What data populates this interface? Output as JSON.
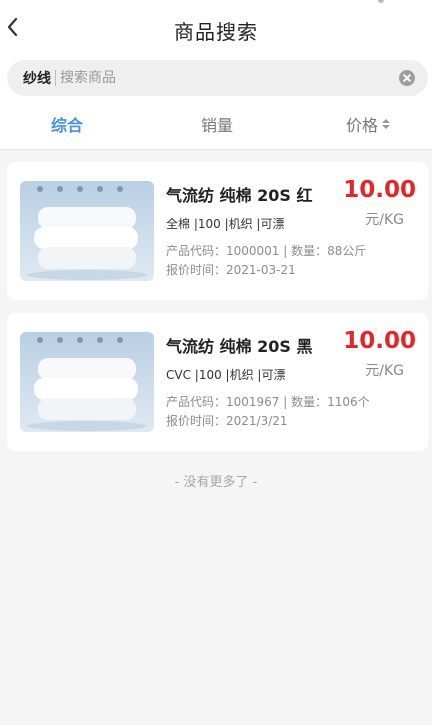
{
  "header": {
    "title": "商品搜索",
    "back_icon": "chevron-left-icon"
  },
  "search": {
    "prefix": "纱线",
    "placeholder": "搜索商品",
    "value": "",
    "clear_icon": "clear-circle-icon"
  },
  "tabs": [
    {
      "label": "综合",
      "active": true
    },
    {
      "label": "销量",
      "active": false
    },
    {
      "label": "价格",
      "active": false,
      "icon": "sort-icon"
    }
  ],
  "products": [
    {
      "name": "气流纺 纯棉 20S 红",
      "spec": "全棉 |100 |机织 |可漂",
      "code_line": "产品代码：1000001 | 数量：88公斤",
      "time_line": "报价时间：2021-03-21",
      "price": "10.00",
      "unit": "元/KG"
    },
    {
      "name": "气流纺 纯棉 20S 黑",
      "spec": "CVC |100 |机织 |可漂",
      "code_line": "产品代码：1001967 | 数量：1106个",
      "time_line": "报价时间：2021/3/21",
      "price": "10.00",
      "unit": "元/KG"
    }
  ],
  "footer": {
    "no_more": "- 没有更多了 -"
  },
  "colors": {
    "accent": "#4a90e2",
    "price": "#e3262a",
    "background": "#f5f5f5"
  }
}
